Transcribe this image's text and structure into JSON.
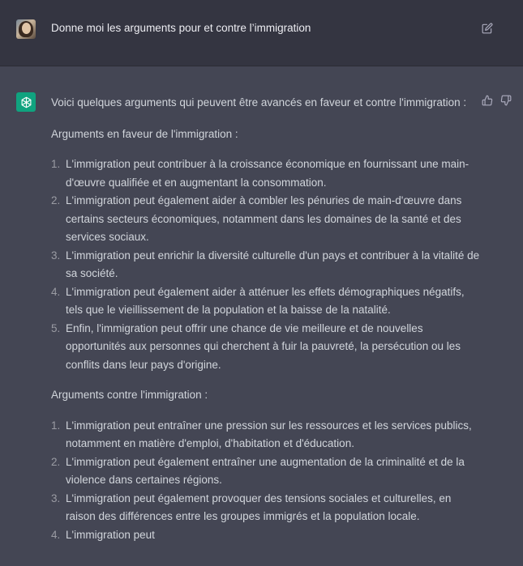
{
  "user_message": {
    "text": "Donne moi les arguments pour et contre l’immigration",
    "edit_icon": "edit-icon"
  },
  "assistant_message": {
    "intro": "Voici quelques arguments qui peuvent être avancés en faveur et contre l'immigration :",
    "pro_heading": "Arguments en faveur de l'immigration :",
    "pro_items": [
      {
        "num": "1.",
        "text": "L'immigration peut contribuer à la croissance économique en fournissant une main-d'œuvre qualifiée et en augmentant la consommation."
      },
      {
        "num": "2.",
        "text": "L'immigration peut également aider à combler les pénuries de main-d'œuvre dans certains secteurs économiques, notamment dans les domaines de la santé et des services sociaux."
      },
      {
        "num": "3.",
        "text": "L'immigration peut enrichir la diversité culturelle d'un pays et contribuer à la vitalité de sa société."
      },
      {
        "num": "4.",
        "text": "L'immigration peut également aider à atténuer les effets démographiques négatifs, tels que le vieillissement de la population et la baisse de la natalité."
      },
      {
        "num": "5.",
        "text": "Enfin, l'immigration peut offrir une chance de vie meilleure et de nouvelles opportunités aux personnes qui cherchent à fuir la pauvreté, la persécution ou les conflits dans leur pays d'origine."
      }
    ],
    "con_heading": "Arguments contre l'immigration :",
    "con_items": [
      {
        "num": "1.",
        "text": "L'immigration peut entraîner une pression sur les ressources et les services publics, notamment en matière d'emploi, d'habitation et d'éducation."
      },
      {
        "num": "2.",
        "text": "L'immigration peut également entraîner une augmentation de la criminalité et de la violence dans certaines régions."
      },
      {
        "num": "3.",
        "text": "L'immigration peut également provoquer des tensions sociales et culturelles, en raison des différences entre les groupes immigrés et la population locale."
      },
      {
        "num": "4.",
        "text": "L'immigration peut"
      }
    ],
    "icons": [
      "openai-logo-icon",
      "thumbs-up-icon",
      "thumbs-down-icon"
    ]
  },
  "colors": {
    "user_bg": "#343541",
    "assistant_bg": "#444654",
    "logo_bg": "#10a37f",
    "text": "#d1d5db"
  }
}
